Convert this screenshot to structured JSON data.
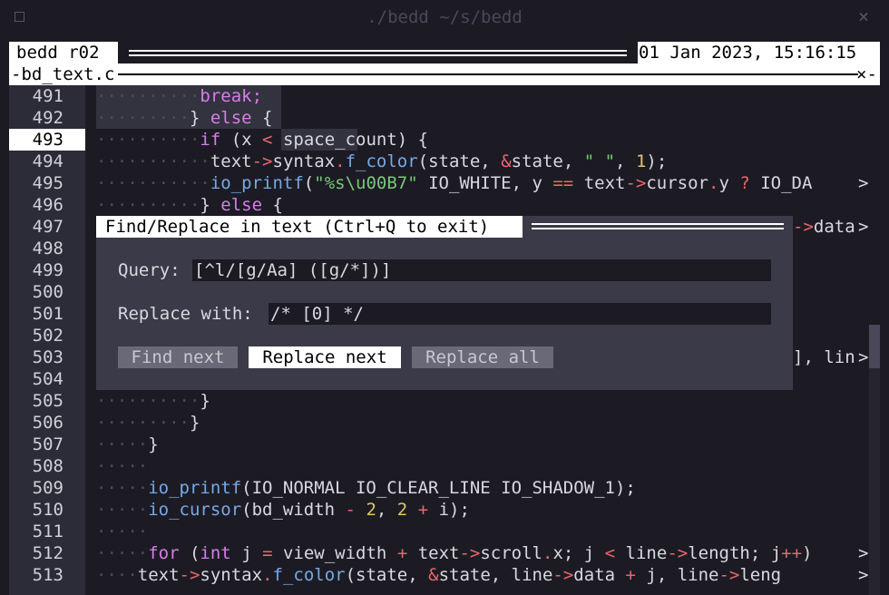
{
  "window": {
    "title": "./bedd ~/s/bedd",
    "menu_glyph": "▫",
    "close_glyph": "×"
  },
  "status": {
    "app_name": "bedd r02",
    "datetime": "01 Jan 2023, 15:16:15"
  },
  "tab": {
    "filename": "-bd_text.c",
    "close_glyph": "×-"
  },
  "gutter": {
    "current": "493",
    "lines": [
      "491",
      "492",
      "493",
      "494",
      "495",
      "496",
      "497",
      "498",
      "499",
      "500",
      "501",
      "502",
      "503",
      "504",
      "505",
      "506",
      "507",
      "508",
      "509",
      "510",
      "511",
      "512",
      "513"
    ]
  },
  "code": {
    "l491_ws": "··········",
    "l491_a": "break;",
    "l492_ws": "·········",
    "l492_a": "} ",
    "l492_b": "else",
    "l492_c": " {",
    "l493_ws": "··········",
    "l493_a": "if",
    "l493_b": " (x ",
    "l493_c": "<",
    "l493_d": " space_count) {",
    "l494_ws": "···········",
    "l494_a": "text",
    "l494_b": "->",
    "l494_c": "syntax",
    "l494_d": ".",
    "l494_e": "f_color",
    "l494_f": "(state, ",
    "l494_g": "&",
    "l494_h": "state, ",
    "l494_i": "\" \"",
    "l494_j": ", ",
    "l494_k": "1",
    "l494_l": ");",
    "l495_ws": "···········",
    "l495_a": "io_printf",
    "l495_b": "(",
    "l495_c": "\"%s\\u00B7\"",
    "l495_d": " IO_WHITE, y ",
    "l495_e": "==",
    "l495_f": " text",
    "l495_g": "->",
    "l495_h": "cursor",
    "l495_i": ".",
    "l495_j": "y ",
    "l495_k": "?",
    "l495_l": " IO_DA",
    "l496_ws": "··········",
    "l496_a": "} ",
    "l496_b": "else",
    "l496_c": " {",
    "l497_a": "->",
    "l497_b": "data",
    "l503_a": "], lin",
    "l505_ws": "··········",
    "l505_a": "}",
    "l506_ws": "·········",
    "l506_a": "}",
    "l507_ws": "·····",
    "l507_a": "}",
    "l508_ws": "·····",
    "l509_ws": "·····",
    "l509_a": "io_printf",
    "l509_b": "(IO_NORMAL IO_CLEAR_LINE IO_SHADOW_1);",
    "l510_ws": "·····",
    "l510_a": "io_cursor",
    "l510_b": "(bd_width ",
    "l510_c": "-",
    "l510_d": " ",
    "l510_e": "2",
    "l510_f": ", ",
    "l510_g": "2",
    "l510_h": " ",
    "l510_i": "+",
    "l510_j": " i);",
    "l511_ws": "·····",
    "l512_ws": "·····",
    "l512_a": "for",
    "l512_b": " (",
    "l512_c": "int",
    "l512_d": " j ",
    "l512_e": "=",
    "l512_f": " view_width ",
    "l512_g": "+",
    "l512_h": " text",
    "l512_i": "->",
    "l512_j": "scroll",
    "l512_k": ".",
    "l512_l": "x; j ",
    "l512_m": "<",
    "l512_n": " line",
    "l512_o": "->",
    "l512_p": "length; j",
    "l512_q": "++",
    "l512_r": ")",
    "l513_ws": "····",
    "l513_a": "text",
    "l513_b": "->",
    "l513_c": "syntax",
    "l513_d": ".",
    "l513_e": "f_color",
    "l513_f": "(state, ",
    "l513_g": "&",
    "l513_h": "state, line",
    "l513_i": "->",
    "l513_j": "data ",
    "l513_k": "+",
    "l513_l": " j, line",
    "l513_m": "->",
    "l513_n": "leng",
    "overflow_glyph": ">"
  },
  "dialog": {
    "title": "Find/Replace in text (Ctrl+Q to exit)",
    "query_label": "Query:",
    "query_value": "[^l/[g/Aa] ([g/*])]",
    "replace_label": "Replace with:",
    "replace_value": "/* [0] */",
    "buttons": {
      "find_next": "Find next",
      "replace_next": "Replace next",
      "replace_all": "Replace all"
    }
  },
  "colors": {
    "background": "#1c1b24",
    "keyword": "#d77ee8",
    "function": "#76a9e6",
    "operator": "#e8676a",
    "number": "#e0c46b",
    "string": "#7ac77a"
  }
}
